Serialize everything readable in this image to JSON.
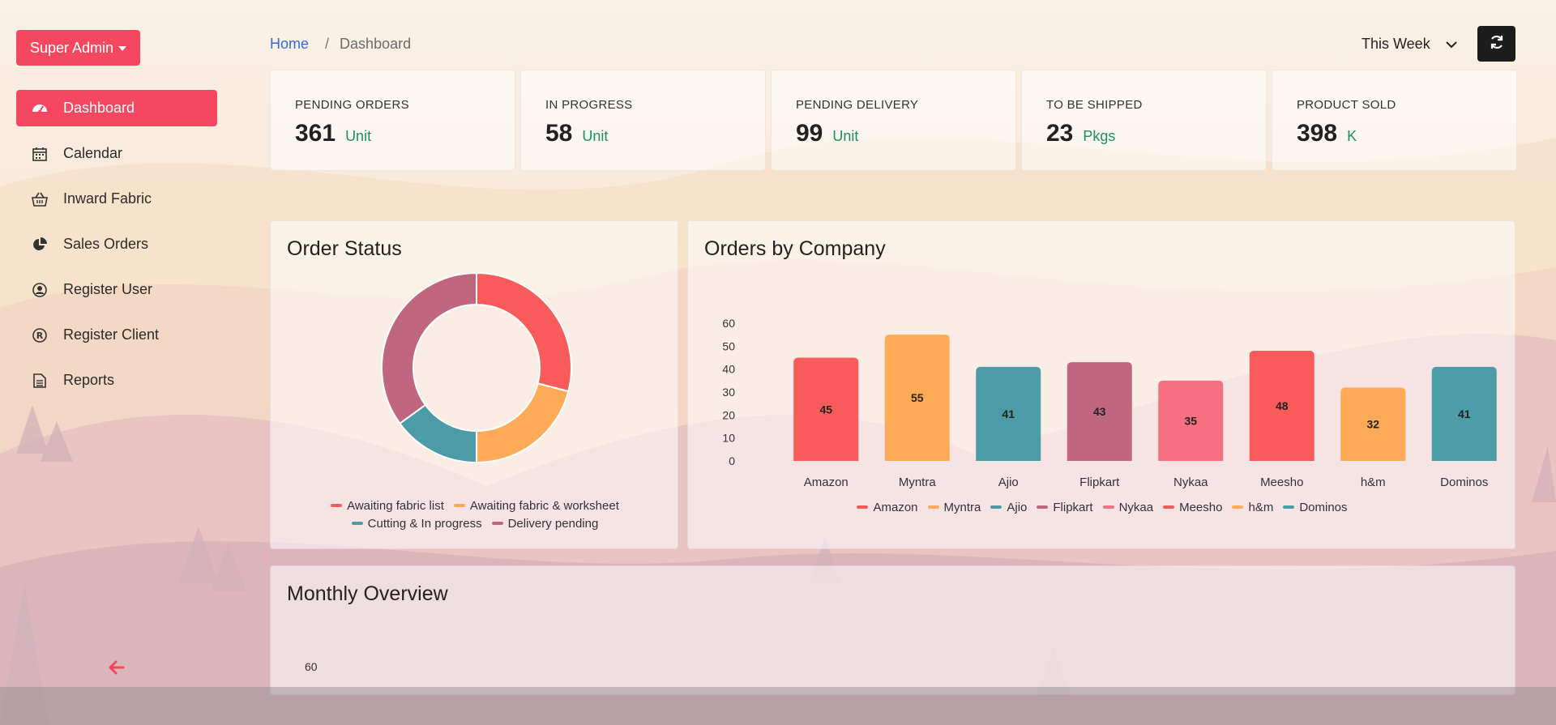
{
  "colors": {
    "accent": "#f5475f",
    "unit_green": "#1e8f5e",
    "series": [
      "#f95a5a",
      "#fdab57",
      "#4c9ca8",
      "#c0677f",
      "#f57081",
      "#f95a5a",
      "#fdab57",
      "#4c9ca8"
    ]
  },
  "sidebar": {
    "user_button": "Super Admin",
    "items": [
      {
        "label": "Dashboard",
        "icon": "dashboard-icon",
        "active": true
      },
      {
        "label": "Calendar",
        "icon": "calendar-icon"
      },
      {
        "label": "Inward Fabric",
        "icon": "basket-icon"
      },
      {
        "label": "Sales Orders",
        "icon": "pie-chart-icon"
      },
      {
        "label": "Register User",
        "icon": "user-circle-icon"
      },
      {
        "label": "Register Client",
        "icon": "registered-icon"
      },
      {
        "label": "Reports",
        "icon": "file-icon"
      }
    ],
    "collapse_icon": "arrow-left-icon"
  },
  "header": {
    "breadcrumb": {
      "home": "Home",
      "separator": "/",
      "current": "Dashboard"
    },
    "period": "This Week",
    "refresh_icon": "refresh-icon"
  },
  "stats": [
    {
      "label": "PENDING ORDERS",
      "value": "361",
      "unit": "Unit"
    },
    {
      "label": "IN PROGRESS",
      "value": "58",
      "unit": "Unit"
    },
    {
      "label": "PENDING DELIVERY",
      "value": "99",
      "unit": "Unit"
    },
    {
      "label": "TO BE SHIPPED",
      "value": "23",
      "unit": "Pkgs"
    },
    {
      "label": "PRODUCT SOLD",
      "value": "398",
      "unit": "K"
    }
  ],
  "panels": {
    "order_status": "Order Status",
    "orders_by_company": "Orders by Company",
    "monthly_overview": "Monthly Overview",
    "monthly_first_tick": "60"
  },
  "chart_data": [
    {
      "type": "pie",
      "title": "Order Status",
      "categories": [
        "Awaiting fabric list",
        "Awaiting fabric & worksheet",
        "Cutting & In progress",
        "Delivery pending"
      ],
      "values": [
        29,
        21,
        15,
        35
      ],
      "colors": [
        "#f95a5a",
        "#fdab57",
        "#4c9ca8",
        "#c0677f"
      ],
      "donut": true,
      "legend": "bottom"
    },
    {
      "type": "bar",
      "title": "Orders by Company",
      "categories": [
        "Amazon",
        "Myntra",
        "Ajio",
        "Flipkart",
        "Nykaa",
        "Meesho",
        "h&m",
        "Dominos"
      ],
      "values": [
        45,
        55,
        41,
        43,
        35,
        48,
        32,
        41
      ],
      "colors": [
        "#f95a5a",
        "#fdab57",
        "#4c9ca8",
        "#c0677f",
        "#f57081",
        "#f95a5a",
        "#fdab57",
        "#4c9ca8"
      ],
      "ylim": [
        0,
        60
      ],
      "yticks": [
        0,
        10,
        20,
        30,
        40,
        50,
        60
      ],
      "grid": false,
      "legend": "bottom"
    }
  ]
}
